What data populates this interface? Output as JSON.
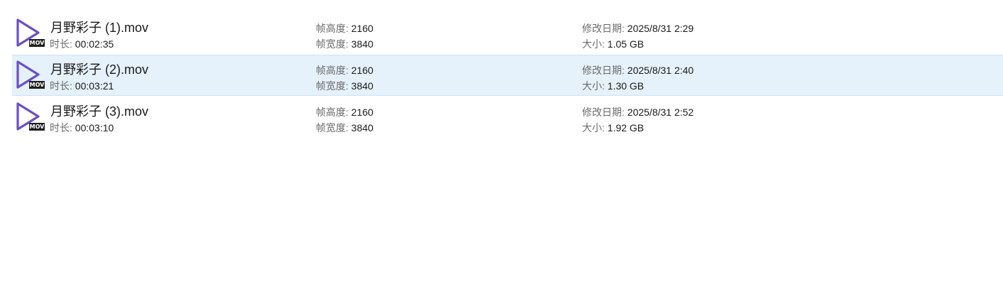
{
  "labels": {
    "duration": "时长: ",
    "frame_height": "帧高度: ",
    "frame_width": "帧宽度: ",
    "modified": "修改日期: ",
    "size": "大小: "
  },
  "icon": {
    "name": "video-play-icon",
    "badge": "MOV",
    "color": "#6a4fc7"
  },
  "files": [
    {
      "name": "月野彩子 (1).mov",
      "duration": "00:02:35",
      "frame_height": "2160",
      "frame_width": "3840",
      "modified": "2025/8/31 2:29",
      "size": "1.05 GB",
      "selected": false
    },
    {
      "name": "月野彩子 (2).mov",
      "duration": "00:03:21",
      "frame_height": "2160",
      "frame_width": "3840",
      "modified": "2025/8/31 2:40",
      "size": "1.30 GB",
      "selected": true
    },
    {
      "name": "月野彩子 (3).mov",
      "duration": "00:03:10",
      "frame_height": "2160",
      "frame_width": "3840",
      "modified": "2025/8/31 2:52",
      "size": "1.92 GB",
      "selected": false
    }
  ]
}
